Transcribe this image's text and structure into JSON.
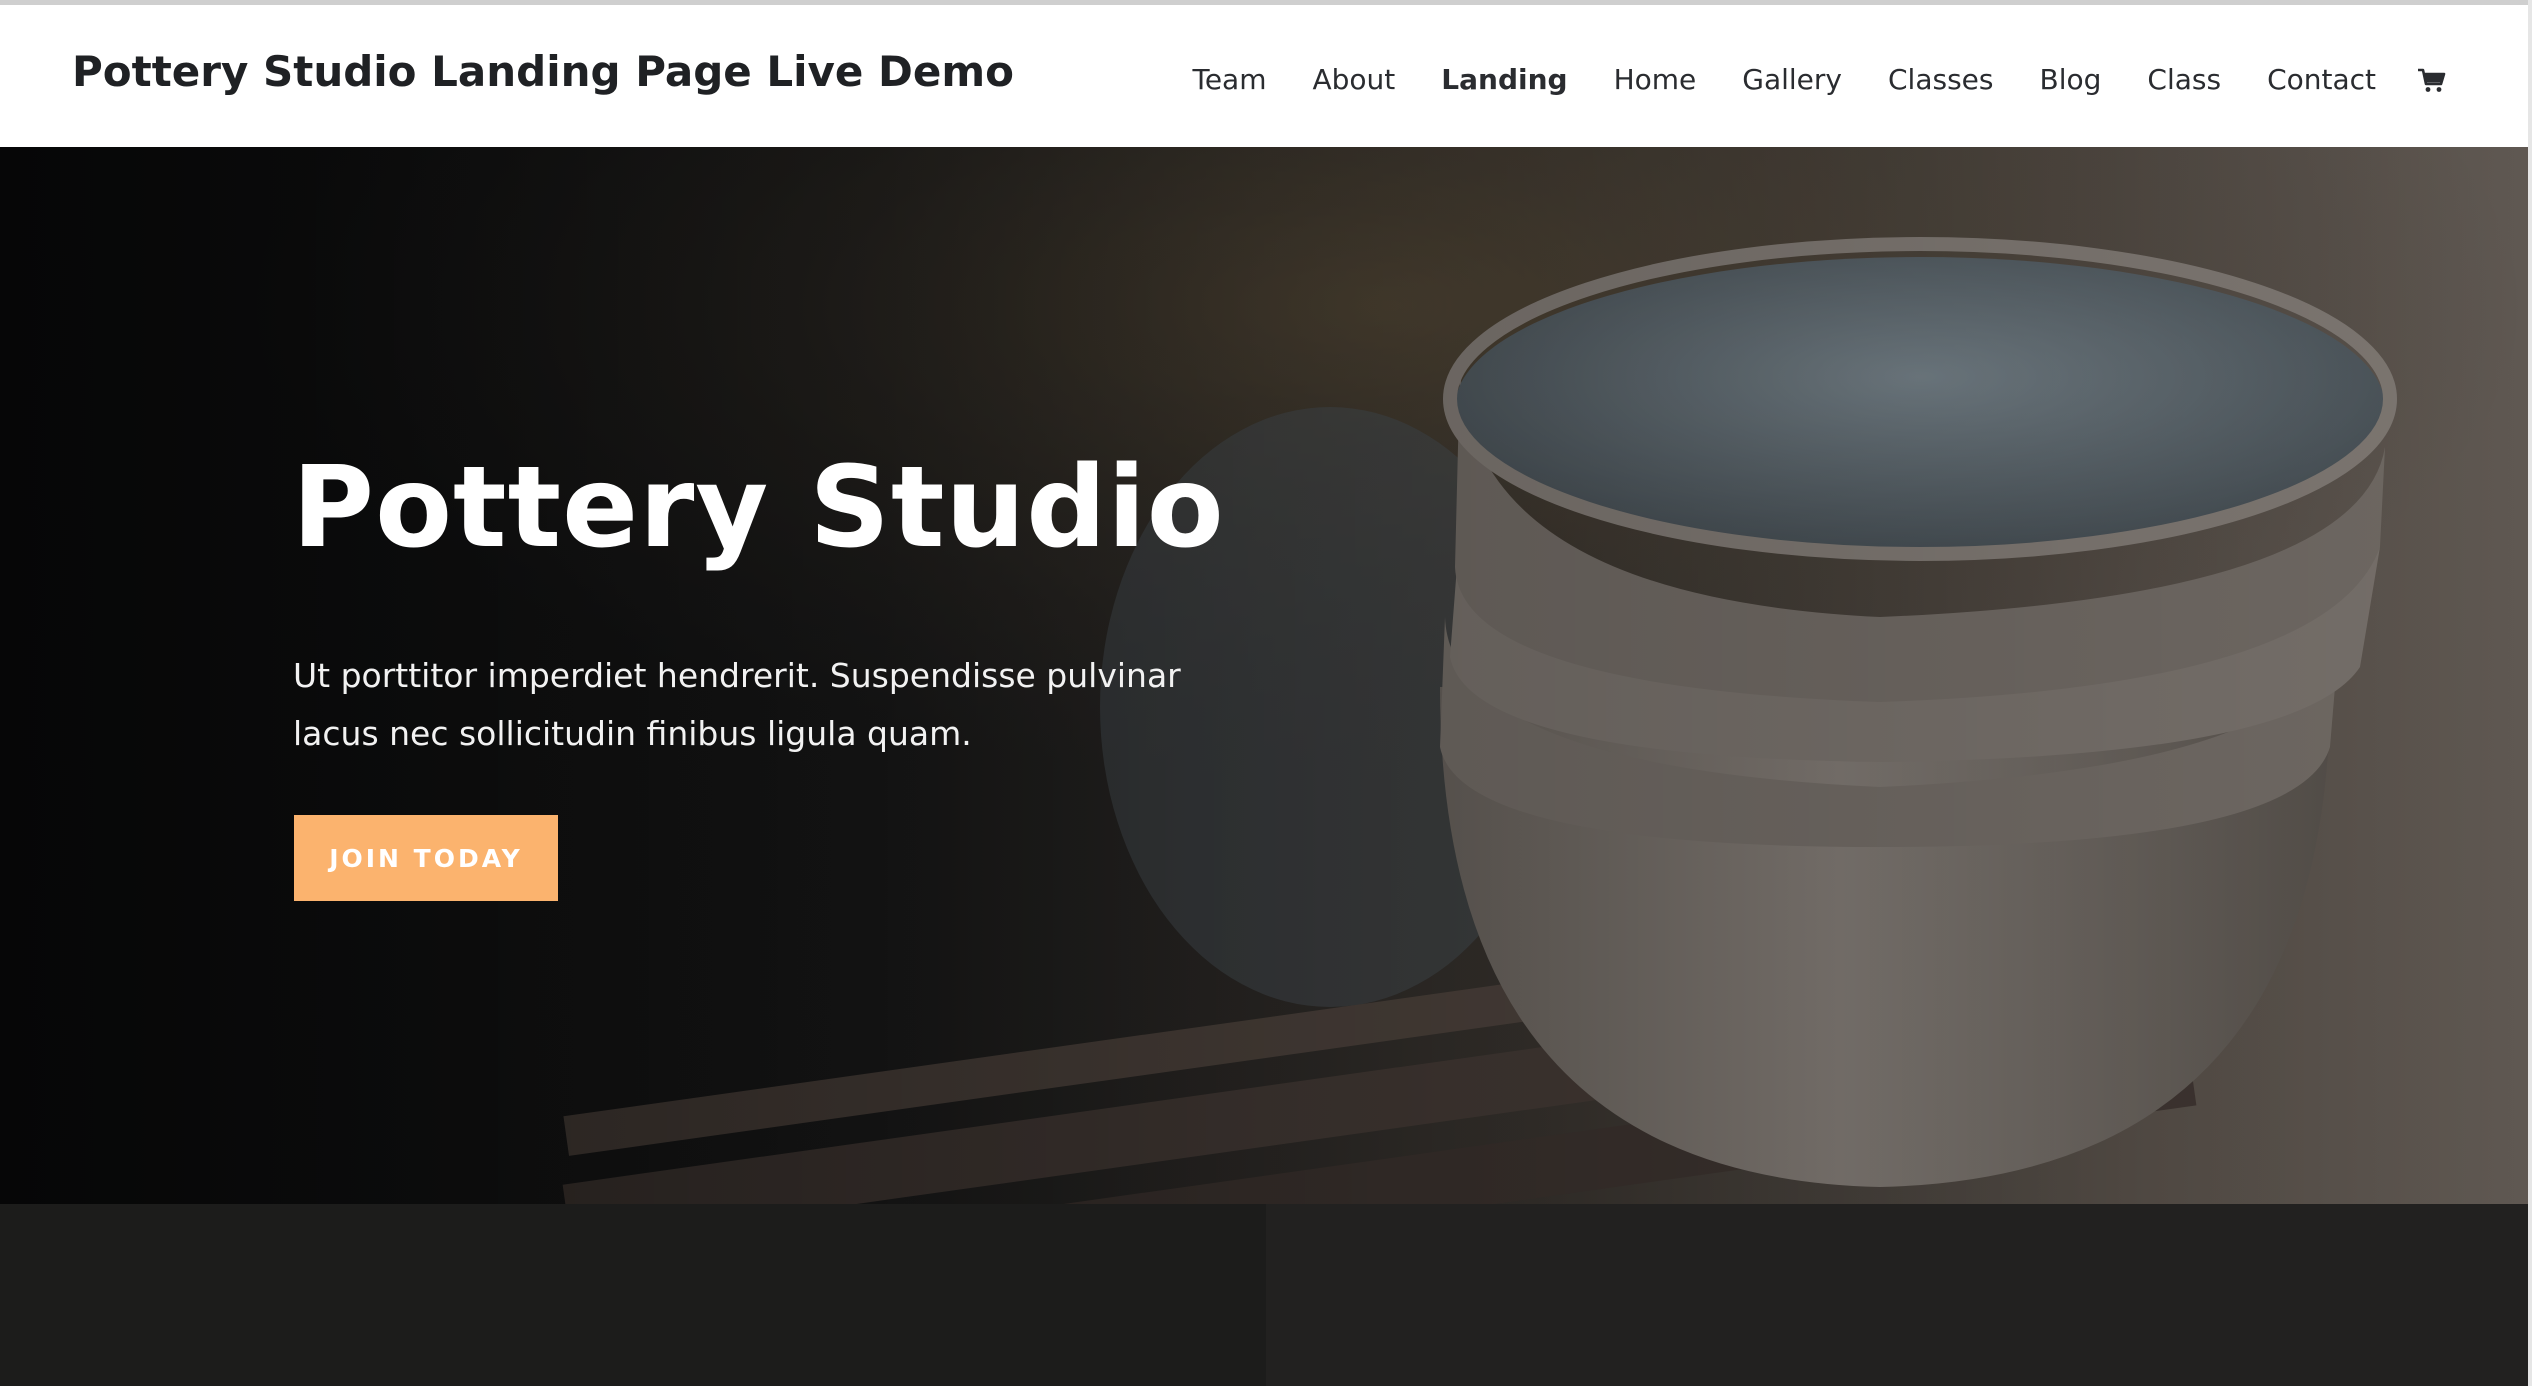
{
  "header": {
    "site_title": "Pottery Studio Landing Page Live Demo",
    "nav": [
      {
        "label": "Team"
      },
      {
        "label": "About"
      },
      {
        "label": "Landing"
      },
      {
        "label": "Home"
      },
      {
        "label": "Gallery"
      },
      {
        "label": "Classes"
      },
      {
        "label": "Blog"
      },
      {
        "label": "Class"
      },
      {
        "label": "Contact"
      }
    ],
    "active_nav": "Landing",
    "cart_icon": "shopping-cart-icon"
  },
  "hero": {
    "title": "Pottery Studio",
    "text": "Ut porttitor imperdiet hendrerit. Suspendisse pulvinar lacus nec sollicitudin finibus ligula quam.",
    "cta_label": "JOIN TODAY",
    "image": "stacked-ceramic-bowls-photo"
  },
  "colors": {
    "accent": "#fbb36e",
    "header_bg": "#ffffff",
    "dark_panel": "#1c1c1b"
  }
}
